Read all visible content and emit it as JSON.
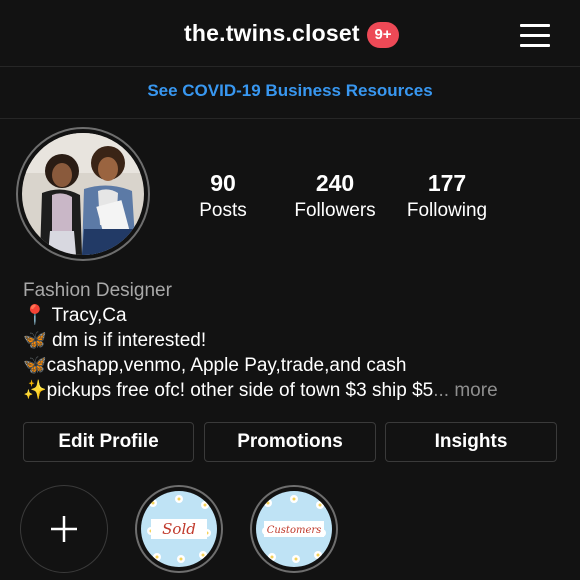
{
  "header": {
    "username": "the.twins.closet",
    "notification_badge": "9+",
    "menu_icon": "hamburger-menu-icon"
  },
  "banner": {
    "text": "See COVID-19 Business Resources"
  },
  "profile": {
    "stats": [
      {
        "value": "90",
        "label": "Posts"
      },
      {
        "value": "240",
        "label": "Followers"
      },
      {
        "value": "177",
        "label": "Following"
      }
    ],
    "category": "Fashion Designer",
    "bio_lines": [
      {
        "emoji": "📍",
        "text": "Tracy,Ca"
      },
      {
        "emoji": "🦋",
        "text": "dm is if interested!"
      },
      {
        "emoji": "🦋",
        "text": "cashapp,venmo, Apple Pay,trade,and cash"
      },
      {
        "emoji": "✨",
        "text": "pickups free ofc! other side of town $3 ship $5"
      }
    ],
    "more_link": "... more"
  },
  "actions": {
    "edit_profile": "Edit Profile",
    "promotions": "Promotions",
    "insights": "Insights"
  },
  "highlights": [
    {
      "title": "Sold"
    },
    {
      "title": "Customers"
    }
  ],
  "colors": {
    "background": "#121212",
    "link_blue": "#3897f0",
    "badge_red": "#ed4956"
  }
}
